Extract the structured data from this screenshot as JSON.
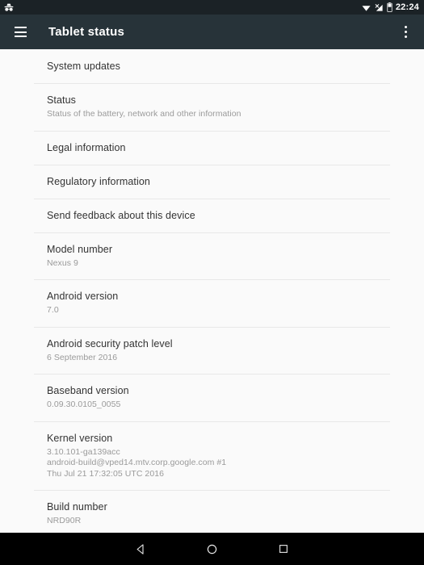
{
  "statusbar": {
    "left_icon": "incognito-icon",
    "icons": [
      "wifi-icon",
      "cellular-no-signal-icon",
      "battery-icon"
    ],
    "time": "22:24"
  },
  "toolbar": {
    "menu_icon": "hamburger-menu-icon",
    "title": "Tablet status",
    "overflow_icon": "overflow-menu-icon"
  },
  "list": {
    "items": [
      {
        "title": "System updates",
        "sub": []
      },
      {
        "title": "Status",
        "sub": [
          "Status of the battery, network and other information"
        ]
      },
      {
        "title": "Legal information",
        "sub": []
      },
      {
        "title": "Regulatory information",
        "sub": []
      },
      {
        "title": "Send feedback about this device",
        "sub": []
      },
      {
        "title": "Model number",
        "sub": [
          "Nexus 9"
        ]
      },
      {
        "title": "Android version",
        "sub": [
          "7.0"
        ]
      },
      {
        "title": "Android security patch level",
        "sub": [
          "6 September 2016"
        ]
      },
      {
        "title": "Baseband version",
        "sub": [
          "0.09.30.0105_0055"
        ]
      },
      {
        "title": "Kernel version",
        "sub": [
          "3.10.101-ga139acc",
          "android-build@vped14.mtv.corp.google.com #1",
          "Thu Jul 21 17:32:05 UTC 2016"
        ]
      },
      {
        "title": "Build number",
        "sub": [
          "NRD90R"
        ]
      }
    ]
  },
  "navbar": {
    "back": "back-triangle-icon",
    "home": "home-circle-icon",
    "recents": "recents-square-icon"
  },
  "colors": {
    "statusbar_bg": "#1B2226",
    "toolbar_bg": "#273339",
    "content_bg": "#FAFAFA",
    "divider": "#E8E8E8",
    "title_text": "#333333",
    "sub_text": "#9A9A9A",
    "navbar_bg": "#000000"
  }
}
